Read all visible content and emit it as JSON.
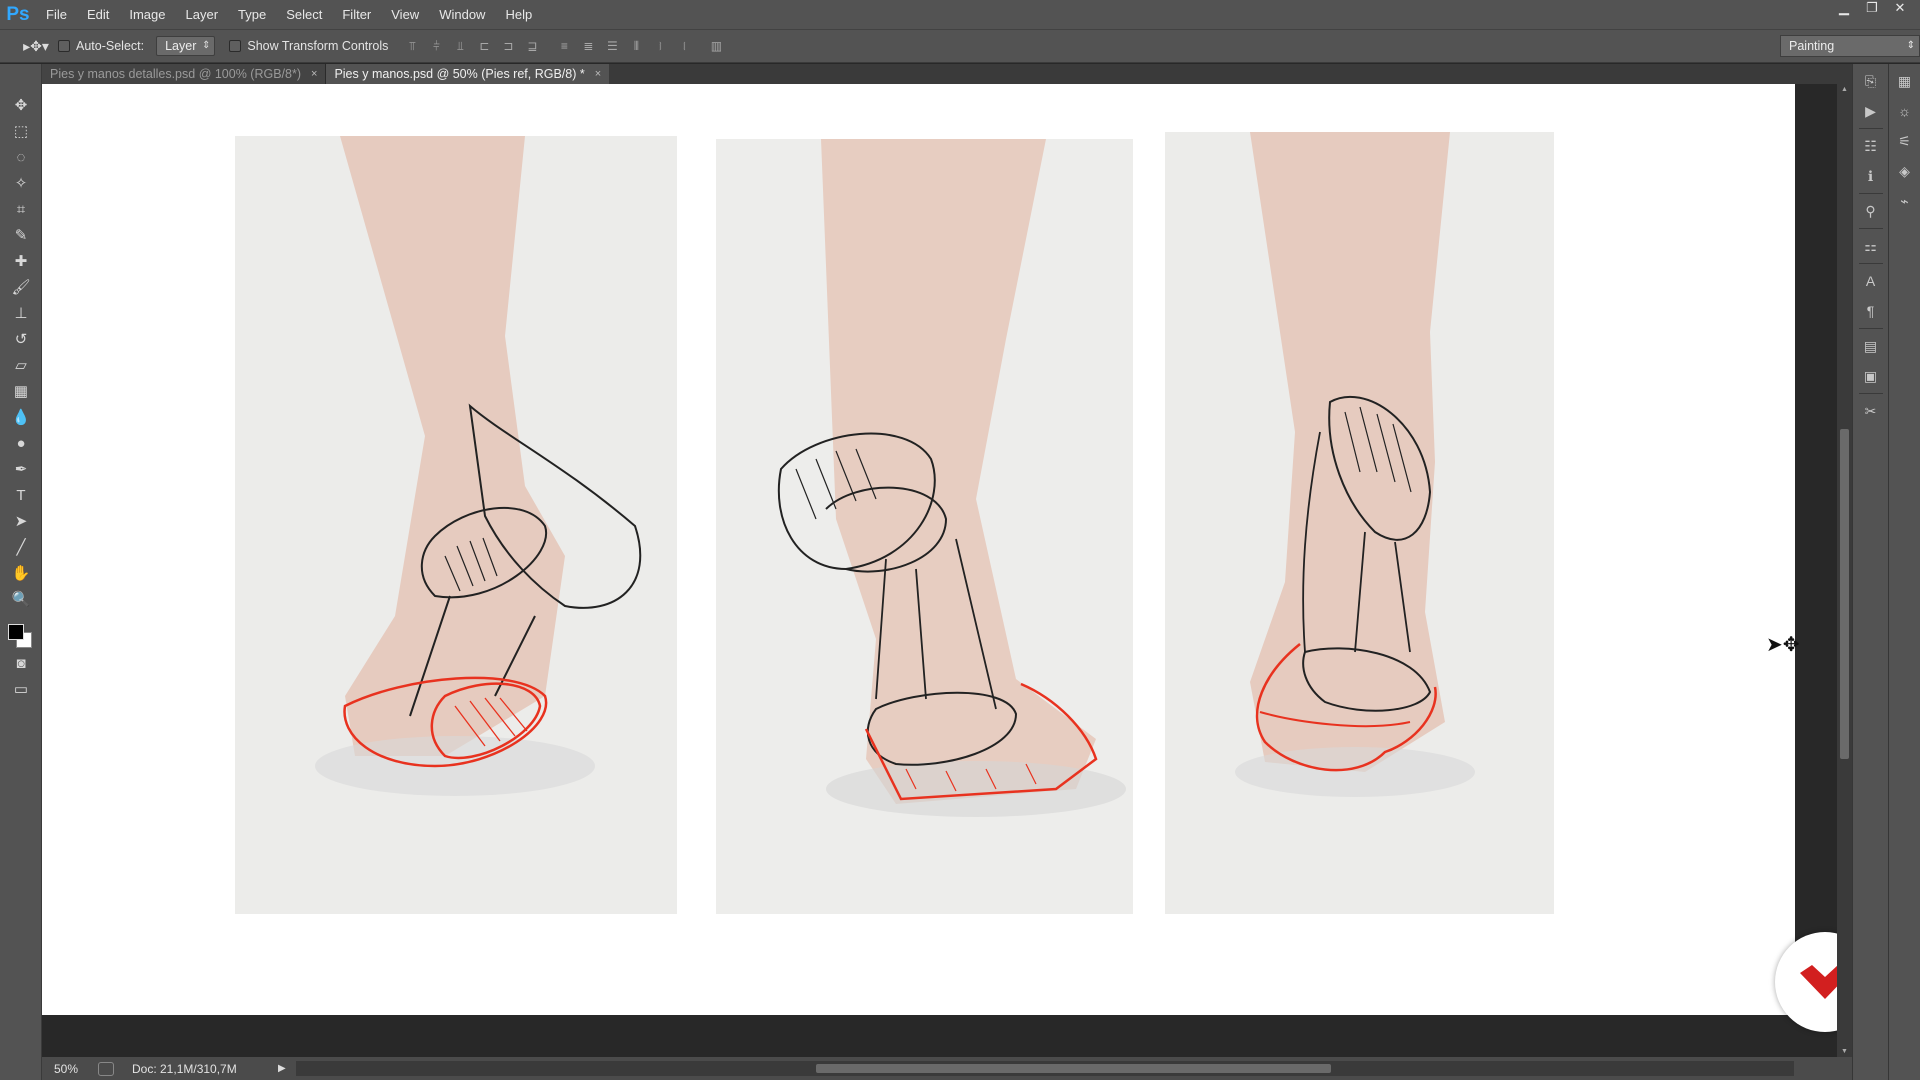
{
  "app": {
    "logo": "Ps"
  },
  "menu": [
    "File",
    "Edit",
    "Image",
    "Layer",
    "Type",
    "Select",
    "Filter",
    "View",
    "Window",
    "Help"
  ],
  "window_controls": {
    "minimize": "▁",
    "restore": "❐",
    "close": "✕"
  },
  "options": {
    "auto_select_label": "Auto-Select:",
    "auto_select_checked": false,
    "auto_select_target": "Layer",
    "transform_label": "Show Transform Controls",
    "transform_checked": false,
    "workspace": "Painting"
  },
  "tabs": [
    {
      "title": "Pies y manos detalles.psd @ 100% (RGB/8*)",
      "active": false,
      "close": "×"
    },
    {
      "title": "Pies y manos.psd @ 50% (Pies ref, RGB/8) *",
      "active": true,
      "close": "×"
    }
  ],
  "tools": [
    "move-tool-icon",
    "marquee-icon",
    "lasso-icon",
    "magic-wand-icon",
    "crop-icon",
    "eyedropper-icon",
    "healing-brush-icon",
    "brush-icon",
    "clone-stamp-icon",
    "history-brush-icon",
    "eraser-icon",
    "gradient-icon",
    "blur-icon",
    "dodge-icon",
    "pen-icon",
    "type-icon",
    "path-selection-icon",
    "line-icon",
    "hand-icon",
    "zoom-icon"
  ],
  "colors": {
    "foreground": "#000000",
    "background": "#ffffff",
    "sketch_red": "#e8321f",
    "sketch_black": "#222222",
    "brand_red": "#d21f1f"
  },
  "status": {
    "zoom": "50%",
    "doc": "Doc: 21,1M/310,7M"
  },
  "canvas": {
    "photos": [
      {
        "name": "foot-reference-left",
        "view": "side-left"
      },
      {
        "name": "foot-reference-front",
        "view": "front"
      },
      {
        "name": "foot-reference-right",
        "view": "side-right"
      }
    ]
  }
}
